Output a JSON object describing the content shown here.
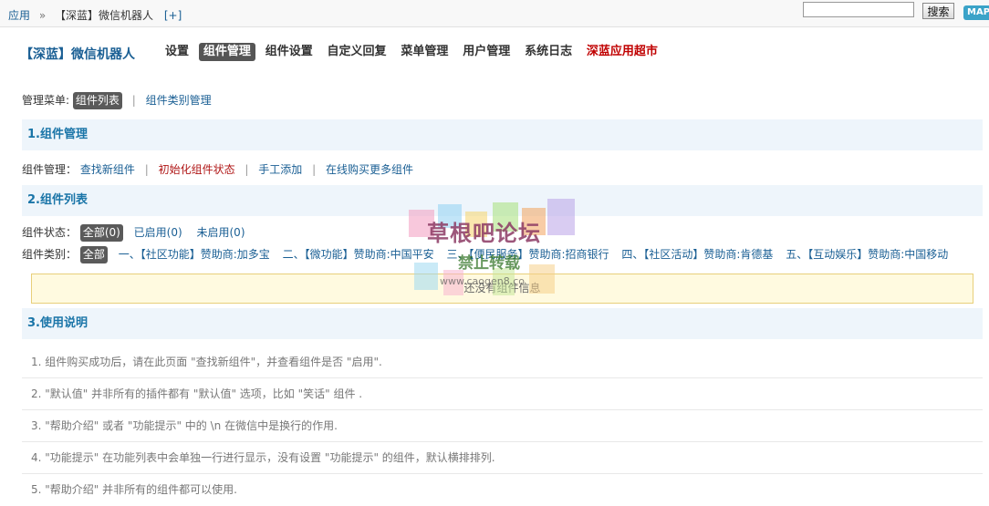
{
  "topbar": {
    "crumbs": [
      "应用",
      "【深蓝】微信机器人"
    ],
    "separator": "»",
    "add_link": "[+]",
    "search_button": "搜索",
    "search_value": "",
    "map_label": "MAP"
  },
  "brand": "【深蓝】微信机器人",
  "nav": [
    {
      "label": "设置"
    },
    {
      "label": "组件管理",
      "active": true
    },
    {
      "label": "组件设置"
    },
    {
      "label": "自定义回复"
    },
    {
      "label": "菜单管理"
    },
    {
      "label": "用户管理"
    },
    {
      "label": "系统日志"
    },
    {
      "label": "深蓝应用超市",
      "market": true
    }
  ],
  "manage_menu": {
    "label": "管理菜单:",
    "items": [
      "组件列表",
      "组件类别管理"
    ]
  },
  "sections": {
    "s1": "1.组件管理",
    "s2": "2.组件列表",
    "s3": "3.使用说明"
  },
  "component_mgmt": {
    "label": "组件管理：",
    "links": [
      "查找新组件",
      "初始化组件状态",
      "手工添加",
      "在线购买更多组件"
    ]
  },
  "status": {
    "label": "组件状态：",
    "all": "全部(0)",
    "enabled": "已启用(0)",
    "disabled": "未启用(0)"
  },
  "category": {
    "label": "组件类别：",
    "all": "全部",
    "items": [
      "一、【社区功能】赞助商:加多宝",
      "二、【微功能】赞助商:中国平安",
      "三、【便民服务】赞助商:招商银行",
      "四、【社区活动】赞助商:肯德基",
      "五、【互动娱乐】赞助商:中国移动"
    ]
  },
  "empty_message": "还没有组件信息",
  "usage": [
    "1. 组件购买成功后，请在此页面 \"查找新组件\"，并查看组件是否 \"启用\".",
    "2. \"默认值\" 并非所有的插件都有 \"默认值\" 选项，比如 \"笑话\" 组件 .",
    "3. \"帮助介绍\" 或者 \"功能提示\" 中的 \\n 在微信中是换行的作用.",
    "4. \"功能提示\" 在功能列表中会单独一行进行显示，没有设置 \"功能提示\" 的组件，默认横排排列.",
    "5. \"帮助介绍\" 并非所有的组件都可以使用."
  ],
  "watermark": {
    "title": "草根吧论坛",
    "subtitle": "禁止转载",
    "url": "www.caogen8.co"
  },
  "colors": {
    "link": "#1a5f94",
    "section_bg": "#eef5fb",
    "section_title": "#1a75a8",
    "market": "#c00000",
    "warning": "#b01717",
    "empty_bg": "#fffae0"
  }
}
